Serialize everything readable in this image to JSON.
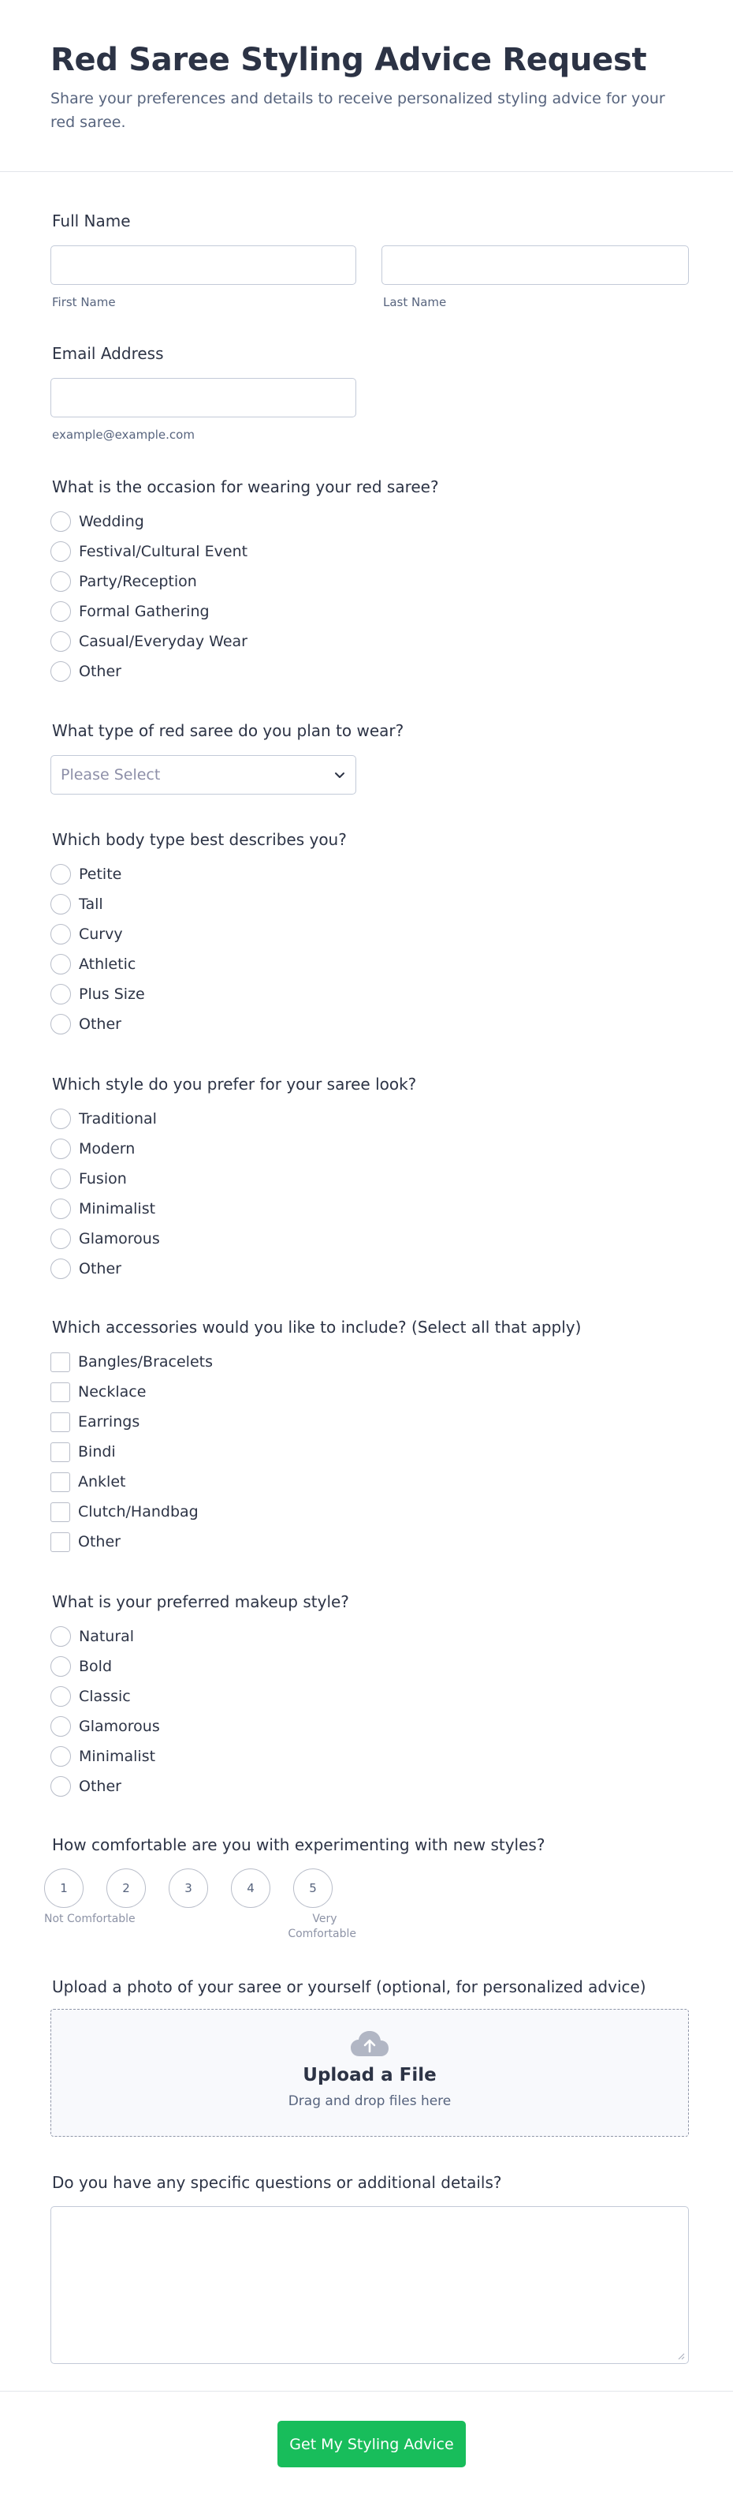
{
  "header": {
    "title": "Red Saree Styling Advice Request",
    "description": "Share your preferences and details to receive personalized styling advice for your red saree."
  },
  "full_name": {
    "label": "Full Name",
    "first_sublabel": "First Name",
    "last_sublabel": "Last Name",
    "first_value": "",
    "last_value": ""
  },
  "email": {
    "label": "Email Address",
    "sublabel": "example@example.com",
    "value": ""
  },
  "occasion": {
    "label": "What is the occasion for wearing your red saree?",
    "options": [
      "Wedding",
      "Festival/Cultural Event",
      "Party/Reception",
      "Formal Gathering",
      "Casual/Everyday Wear",
      "Other"
    ]
  },
  "saree_type": {
    "label": "What type of red saree do you plan to wear?",
    "placeholder": "Please Select"
  },
  "body_type": {
    "label": "Which body type best describes you?",
    "options": [
      "Petite",
      "Tall",
      "Curvy",
      "Athletic",
      "Plus Size",
      "Other"
    ]
  },
  "style": {
    "label": "Which style do you prefer for your saree look?",
    "options": [
      "Traditional",
      "Modern",
      "Fusion",
      "Minimalist",
      "Glamorous",
      "Other"
    ]
  },
  "accessories": {
    "label": "Which accessories would you like to include? (Select all that apply)",
    "options": [
      "Bangles/Bracelets",
      "Necklace",
      "Earrings",
      "Bindi",
      "Anklet",
      "Clutch/Handbag",
      "Other"
    ]
  },
  "makeup": {
    "label": "What is your preferred makeup style?",
    "options": [
      "Natural",
      "Bold",
      "Classic",
      "Glamorous",
      "Minimalist",
      "Other"
    ]
  },
  "comfort": {
    "label": "How comfortable are you with experimenting with new styles?",
    "scale": [
      "1",
      "2",
      "3",
      "4",
      "5"
    ],
    "min_caption": "Not Comfortable",
    "max_caption_line1": "Very",
    "max_caption_line2": "Comfortable"
  },
  "upload": {
    "label": "Upload a photo of your saree or yourself (optional, for personalized advice)",
    "title": "Upload a File",
    "subtitle": "Drag and drop files here",
    "icon": "cloud-upload-icon"
  },
  "details": {
    "label": "Do you have any specific questions or additional details?",
    "value": ""
  },
  "submit": {
    "label": "Get My Styling Advice"
  },
  "colors": {
    "accent": "#18bd5b",
    "text": "#2c3345",
    "subtext": "#57647e",
    "border": "#c3cad8"
  }
}
